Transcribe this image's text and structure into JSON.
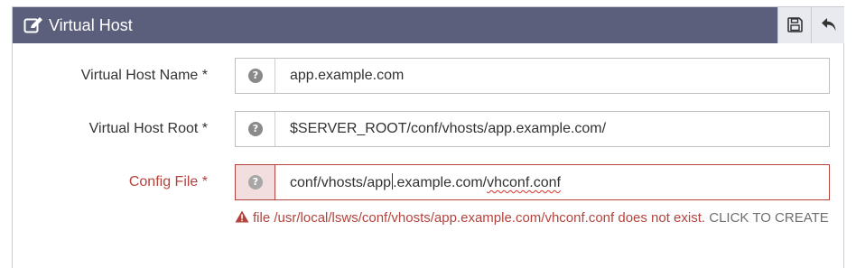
{
  "header": {
    "title": "Virtual Host",
    "title_icon": "edit-icon",
    "save_icon": "save-icon",
    "back_icon": "back-icon"
  },
  "form": {
    "fields": [
      {
        "label": "Virtual Host Name *",
        "value": "app.example.com",
        "help_icon": "help-icon"
      },
      {
        "label": "Virtual Host Root *",
        "value": "$SERVER_ROOT/conf/vhosts/app.example.com/",
        "help_icon": "help-icon"
      },
      {
        "label": "Config File *",
        "value_part1": "conf/vhosts/app",
        "value_part2": ".example.com/",
        "value_part3": "vhconf.conf",
        "help_icon": "help-icon",
        "error": {
          "message": "file /usr/local/lsws/conf/vhosts/app.example.com/vhconf.conf does not exist.",
          "action": "CLICK TO CREATE",
          "icon": "warning-icon"
        }
      }
    ]
  },
  "colors": {
    "header_bg": "#5b5f7c",
    "error": "#b5433d",
    "error_addon_bg": "#f2dede"
  }
}
